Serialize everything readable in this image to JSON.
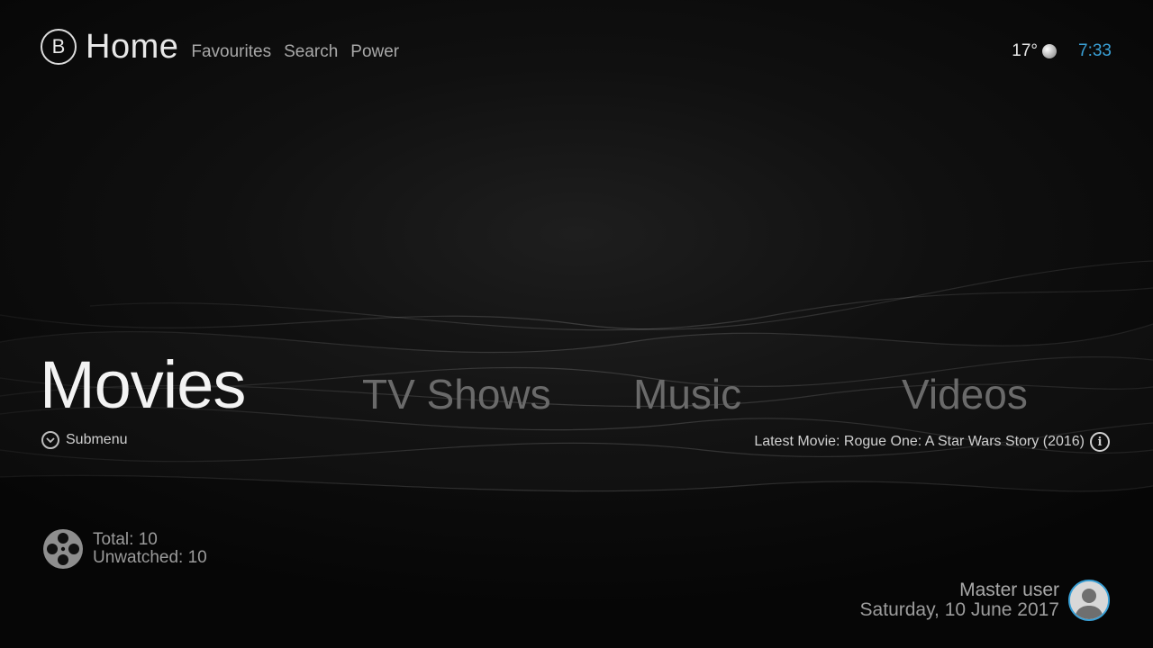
{
  "header": {
    "logo_letter": "B",
    "title": "Home",
    "links": [
      "Favourites",
      "Search",
      "Power"
    ]
  },
  "status": {
    "temperature": "17°",
    "weather_icon": "moon-icon",
    "time": "7:33"
  },
  "menu": {
    "items": [
      "Movies",
      "TV Shows",
      "Music",
      "Videos"
    ],
    "selected": "Movies"
  },
  "submenu": {
    "label": "Submenu",
    "icon": "chevron-down-circle-icon"
  },
  "latest": {
    "label": "Latest Movie: Rogue One: A Star Wars Story (2016)",
    "icon": "info-icon"
  },
  "stats": {
    "icon": "film-reel-icon",
    "total": "Total: 10",
    "unwatched": "Unwatched: 10"
  },
  "user": {
    "name": "Master user",
    "date": "Saturday, 10 June 2017",
    "icon": "avatar-icon"
  },
  "colors": {
    "accent": "#3aa0d6",
    "background": "#050505"
  }
}
